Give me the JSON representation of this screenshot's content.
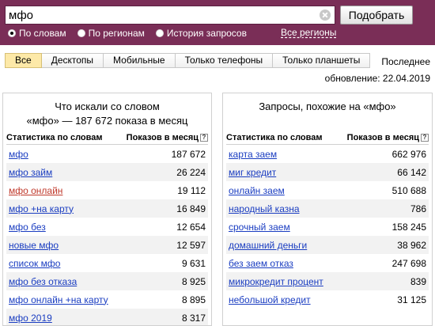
{
  "search": {
    "value": "мфо",
    "submit_label": "Подобрать"
  },
  "modes": [
    {
      "label": "По словам",
      "checked": true
    },
    {
      "label": "По регионам",
      "checked": false
    },
    {
      "label": "История запросов",
      "checked": false
    }
  ],
  "regions_link": "Все регионы",
  "tabs": [
    {
      "label": "Все",
      "active": true
    },
    {
      "label": "Десктопы",
      "active": false
    },
    {
      "label": "Мобильные",
      "active": false
    },
    {
      "label": "Только телефоны",
      "active": false
    },
    {
      "label": "Только планшеты",
      "active": false
    }
  ],
  "updated": {
    "line1": "Последнее",
    "line2": "обновление: 22.04.2019"
  },
  "left_panel": {
    "title_line1": "Что искали со словом",
    "title_line2": "«мфо» — 187 672 показа в месяц",
    "col_words": "Статистика по словам",
    "col_shows": "Показов в месяц",
    "help": "?",
    "rows": [
      {
        "phrase": "мфо",
        "count": "187 672",
        "visited": false
      },
      {
        "phrase": "мфо займ",
        "count": "26 224",
        "visited": false
      },
      {
        "phrase": "мфо онлайн",
        "count": "19 112",
        "visited": true
      },
      {
        "phrase": "мфо +на карту",
        "count": "16 849",
        "visited": false
      },
      {
        "phrase": "мфо без",
        "count": "12 654",
        "visited": false
      },
      {
        "phrase": "новые мфо",
        "count": "12 597",
        "visited": false
      },
      {
        "phrase": "список мфо",
        "count": "9 631",
        "visited": false
      },
      {
        "phrase": "мфо без отказа",
        "count": "8 925",
        "visited": false
      },
      {
        "phrase": "мфо онлайн +на карту",
        "count": "8 895",
        "visited": false
      },
      {
        "phrase": "мфо 2019",
        "count": "8 317",
        "visited": false
      }
    ]
  },
  "right_panel": {
    "title": "Запросы, похожие на «мфо»",
    "col_words": "Статистика по словам",
    "col_shows": "Показов в месяц",
    "help": "?",
    "rows": [
      {
        "phrase": "карта заем",
        "count": "662 976"
      },
      {
        "phrase": "миг кредит",
        "count": "66 142"
      },
      {
        "phrase": "онлайн заем",
        "count": "510 688"
      },
      {
        "phrase": "народный казна",
        "count": "786"
      },
      {
        "phrase": "срочный заем",
        "count": "158 245"
      },
      {
        "phrase": "домашний деньги",
        "count": "38 962"
      },
      {
        "phrase": "без заем отказ",
        "count": "247 698"
      },
      {
        "phrase": "микрокредит процент",
        "count": "839"
      },
      {
        "phrase": "небольшой кредит",
        "count": "31 125"
      }
    ]
  }
}
